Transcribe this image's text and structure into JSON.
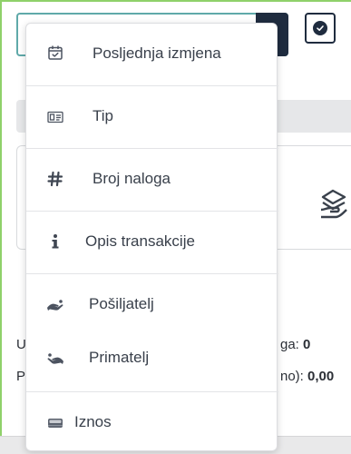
{
  "background": {
    "line1_left": "U",
    "line1_right_label": "ga:",
    "line1_right_value": "0",
    "line2_left": "P",
    "line2_right_label": "no):",
    "line2_right_value": "0,00"
  },
  "menu": {
    "items": [
      {
        "label": "Posljednja izmjena",
        "icon": "calendar-check-icon"
      },
      {
        "label": "Tip",
        "icon": "id-card-icon"
      },
      {
        "label": "Broj naloga",
        "icon": "hash-icon"
      },
      {
        "label": "Opis transakcije",
        "icon": "info-icon"
      },
      {
        "label": "Pošiljatelj",
        "icon": "sender-hand-icon"
      },
      {
        "label": "Primatelj",
        "icon": "receiver-hand-icon"
      },
      {
        "label": "Iznos",
        "icon": "money-icon"
      }
    ]
  },
  "colors": {
    "accent_dark": "#1f2c3f",
    "input_border": "#5fa9a9",
    "frame_border": "#8fd16a"
  }
}
